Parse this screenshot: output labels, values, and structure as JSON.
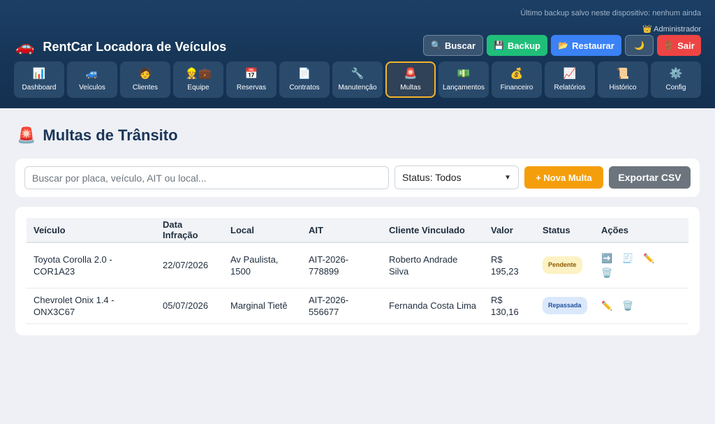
{
  "header": {
    "backup_note": "Último backup salvo neste dispositivo: nenhum ainda",
    "admin_icon": "👑",
    "admin_label": "Administrador",
    "brand_icon": "🚗",
    "brand_title": "RentCar Locadora de Veículos",
    "actions": {
      "buscar_icon": "🔍",
      "buscar": "Buscar",
      "backup_icon": "💾",
      "backup": "Backup",
      "restaurar_icon": "📂",
      "restaurar": "Restaurar",
      "theme_icon": "🌙",
      "sair_icon": "🚪",
      "sair": "Sair"
    }
  },
  "nav": [
    {
      "icon": "📊",
      "label": "Dashboard"
    },
    {
      "icon": "🚙",
      "label": "Veículos"
    },
    {
      "icon": "🧑",
      "label": "Clientes"
    },
    {
      "icon": "👷💼",
      "label": "Equipe"
    },
    {
      "icon": "📅",
      "label": "Reservas"
    },
    {
      "icon": "📄",
      "label": "Contratos"
    },
    {
      "icon": "🔧",
      "label": "Manutenção"
    },
    {
      "icon": "🚨",
      "label": "Multas"
    },
    {
      "icon": "💵",
      "label": "Lançamentos"
    },
    {
      "icon": "💰",
      "label": "Financeiro"
    },
    {
      "icon": "📈",
      "label": "Relatórios"
    },
    {
      "icon": "📜",
      "label": "Histórico"
    },
    {
      "icon": "⚙️",
      "label": "Config"
    }
  ],
  "page": {
    "title_icon": "🚨",
    "title": "Multas de Trânsito"
  },
  "filters": {
    "search_placeholder": "Buscar por placa, veículo, AIT ou local...",
    "status_value": "Status: Todos",
    "new_button": "+ Nova Multa",
    "export_button": "Exportar CSV"
  },
  "table": {
    "headers": [
      "Veículo",
      "Data Infração",
      "Local",
      "AIT",
      "Cliente Vinculado",
      "Valor",
      "Status",
      "Ações"
    ],
    "rows": [
      {
        "veiculo": "Toyota Corolla 2.0 - COR1A23",
        "data": "22/07/2026",
        "local": "Av Paulista, 1500",
        "ait": "AIT-2026-778899",
        "cliente": "Roberto Andrade Silva",
        "valor": "R$ 195,23",
        "status": "Pendente"
      },
      {
        "veiculo": "Chevrolet Onix 1.4 - ONX3C67",
        "data": "05/07/2026",
        "local": "Marginal Tietê",
        "ait": "AIT-2026-556677",
        "cliente": "Fernanda Costa Lima",
        "valor": "R$ 130,16",
        "status": "Repassada"
      }
    ],
    "action_icons": {
      "transfer": "➡️",
      "invoice": "🧾",
      "edit": "✏️",
      "delete": "🗑️"
    }
  }
}
